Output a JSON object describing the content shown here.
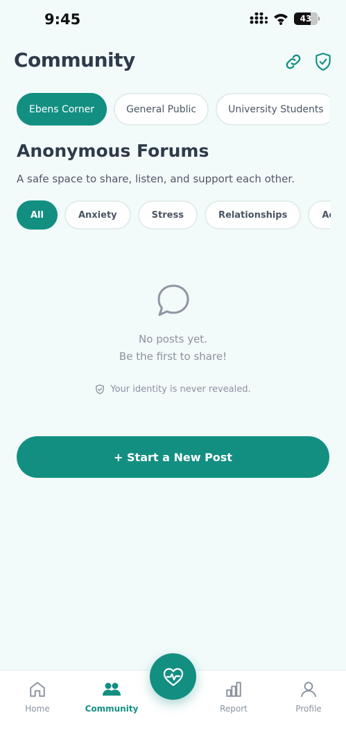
{
  "status_bar": {
    "time": "9:45",
    "battery_level": "43"
  },
  "header": {
    "title": "Community"
  },
  "groups": [
    {
      "label": "Ebens Corner",
      "active": true
    },
    {
      "label": "General Public",
      "active": false
    },
    {
      "label": "University Students",
      "active": false
    },
    {
      "label": "",
      "active": false
    }
  ],
  "forum": {
    "title": "Anonymous Forums",
    "subtitle": "A safe space to share, listen, and support each other."
  },
  "filters": [
    {
      "label": "All",
      "active": true
    },
    {
      "label": "Anxiety",
      "active": false
    },
    {
      "label": "Stress",
      "active": false
    },
    {
      "label": "Relationships",
      "active": false
    },
    {
      "label": "Academics",
      "active": false
    }
  ],
  "empty_state": {
    "line1": "No posts yet.",
    "line2": "Be the first to share!",
    "identity_note": "Your identity is never revealed."
  },
  "new_post_button": "+ Start a New Post",
  "nav": {
    "home": "Home",
    "community": "Community",
    "report": "Report",
    "profile": "Profile"
  },
  "colors": {
    "accent": "#138f82",
    "background": "#f2fbfa",
    "muted_text": "#8a93a0"
  },
  "icons": [
    "link-icon",
    "shield-check-icon",
    "chat-bubble-icon",
    "heart-pulse-icon",
    "home-icon",
    "users-icon",
    "bar-chart-icon",
    "user-icon"
  ]
}
